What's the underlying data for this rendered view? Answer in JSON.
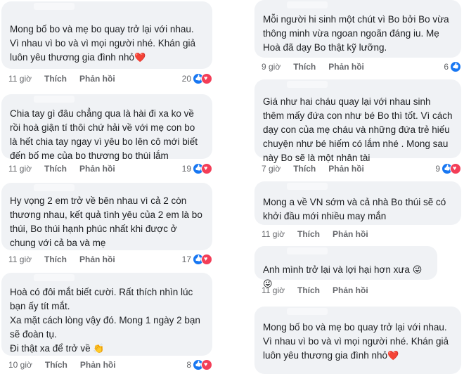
{
  "labels": {
    "like": "Thích",
    "reply": "Phản hồi"
  },
  "left": [
    {
      "text": "Mong bố bo và mẹ bo quay trở lại với nhau. Vì nhau vì bo và vì mọi người nhé. Khán giả luôn yêu thương gia đình nhỏ",
      "emoji": "❤️",
      "time": "11 giờ",
      "reactions": "20"
    },
    {
      "text": "Chia tay gì đâu chẳng qua là hài đi xa ko về rồi hoà giận tí thôi chứ hải về với mẹ con bo là hết chia tay ngay vì yêu bo lên cô mới biết đến bố me của bo thương bo thúi lắm",
      "emoji": "",
      "time": "11 giờ",
      "reactions": "19"
    },
    {
      "text": "Hy vọng 2 em trở về bên nhau vì cả 2 còn thương nhau, kết quả tình yêu của 2 em là bo thúi, Bo thúi hạnh phúc nhất khi được ở chung với cả ba và mẹ",
      "emoji": "",
      "time": "11 giờ",
      "reactions": "17"
    },
    {
      "text": "Hoà có đôi mắt biết cười. Rất thích nhìn lúc bạn ấy tít mắt.\nXa mặt cách lòng vậy đó. Mong 1 ngày 2 bạn sẽ đoàn tụ.\nĐi thật xa để trở về",
      "emoji": "👏",
      "time": "10 giờ",
      "reactions": "8"
    }
  ],
  "right": [
    {
      "text": "Mỗi người hi sinh một chút vì Bo bởi Bo vừa thông minh vừa ngoan ngoãn đáng iu. Mẹ Hoà đã dạy Bo thật kỹ lưỡng.",
      "emoji": "",
      "time": "9 giờ",
      "reactions": "6"
    },
    {
      "text": "Giá như hai cháu quay lại với nhau sinh thêm mấy đứa con như bé Bo thì tốt. Vì cách dạy con của mẹ cháu  và những đứa trẻ hiếu chuyện như bé hiếm có lắm nhé . Mong sau này Bo sẽ là một nhân tài",
      "emoji": "",
      "time": "7 giờ",
      "reactions": "9"
    },
    {
      "text": "Mong a về VN sớm và cả nhà Bo thúi sẽ có khởi đầu mới nhiều may mắn",
      "emoji": "",
      "time": "11 giờ",
      "reactions": ""
    },
    {
      "text": "Anh mình trở lại và lợi hại hơn xưa",
      "emoji": "😜😜",
      "time": "11 giờ",
      "reactions": ""
    },
    {
      "text": "Mong bố bo và mẹ bo quay trở lại với nhau. Vì nhau vì bo và vì mọi người nhé. Khán giả luôn yêu thương gia đình nhỏ",
      "emoji": "❤️",
      "time": "",
      "reactions": ""
    }
  ]
}
